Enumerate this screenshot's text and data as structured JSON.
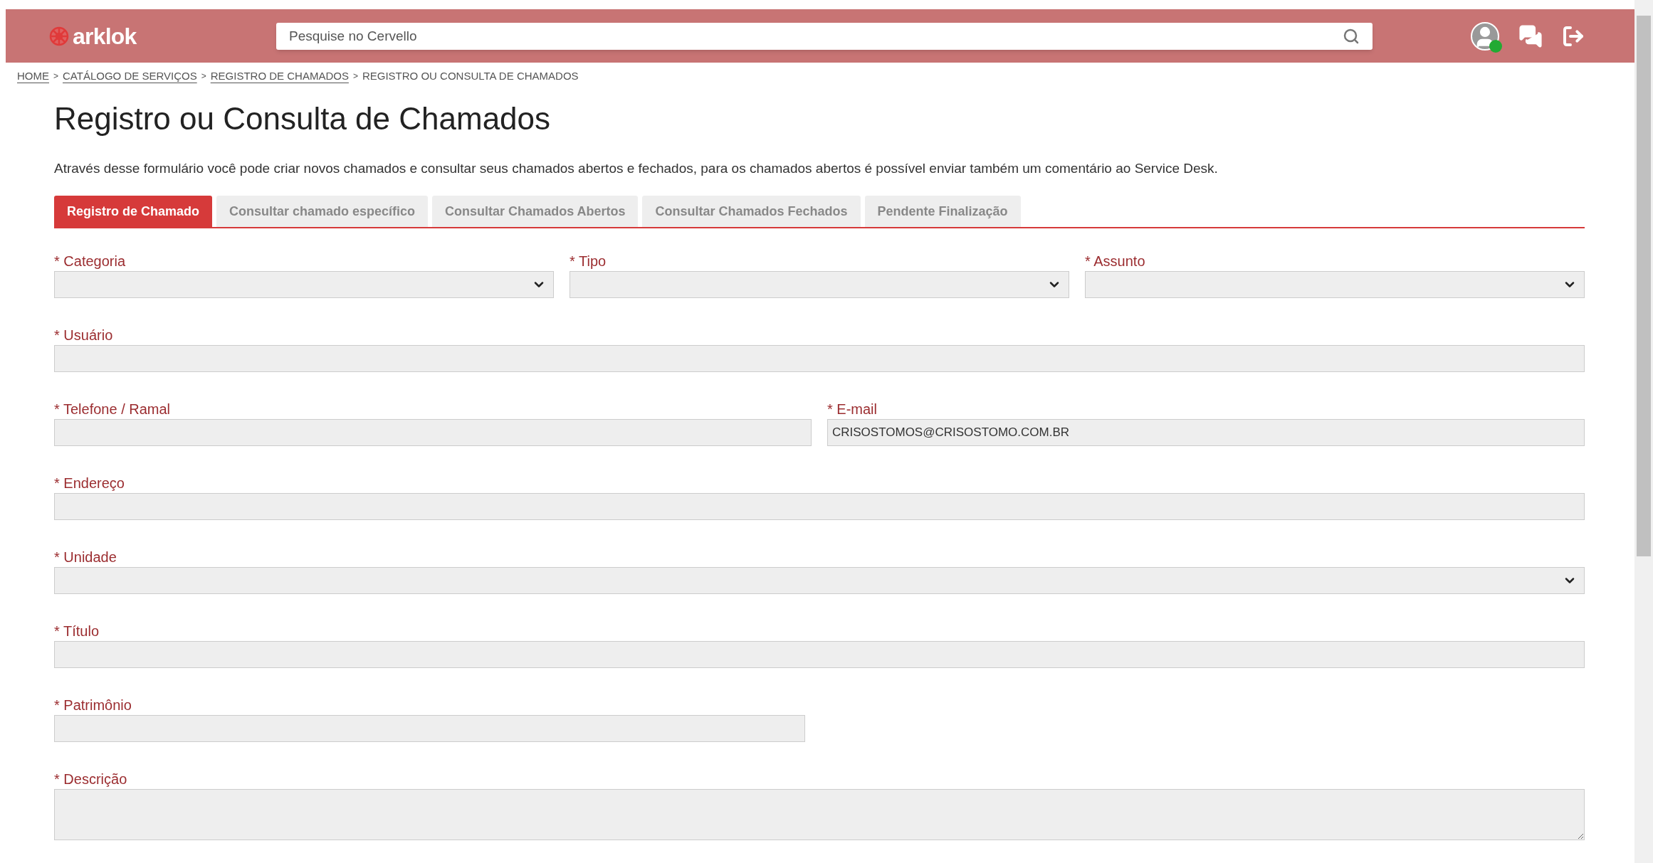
{
  "header": {
    "logo": "arklok",
    "search": {
      "placeholder": "Pesquise no Cervello"
    },
    "user_online": true
  },
  "breadcrumb": [
    {
      "label": "HOME",
      "link": true
    },
    {
      "label": "CATÁLOGO DE SERVIÇOS",
      "link": true
    },
    {
      "label": "REGISTRO DE CHAMADOS",
      "link": true
    },
    {
      "label": "REGISTRO OU CONSULTA DE CHAMADOS",
      "link": false
    }
  ],
  "breadcrumb_separator": ">",
  "title": "Registro ou Consulta de Chamados",
  "description": "Através desse formulário você pode criar novos chamados e consultar seus chamados abertos e fechados, para os chamados abertos é possível enviar também um comentário ao Service Desk.",
  "tabs": [
    {
      "label": "Registro de Chamado",
      "selected": true
    },
    {
      "label": "Consultar chamado específico",
      "selected": false
    },
    {
      "label": "Consultar Chamados Abertos",
      "selected": false
    },
    {
      "label": "Consultar Chamados Fechados",
      "selected": false
    },
    {
      "label": "Pendente Finalização",
      "selected": false
    }
  ],
  "form_rows": [
    [
      {
        "label": "* Categoria",
        "kind": "select"
      },
      {
        "label": "* Tipo",
        "kind": "select"
      },
      {
        "label": "* Assunto",
        "kind": "select"
      }
    ],
    [
      {
        "label": "* Usuário",
        "kind": "text"
      }
    ],
    [
      {
        "label": "* Telefone / Ramal",
        "kind": "text"
      },
      {
        "label": "* E-mail",
        "kind": "text",
        "value": "CRISOSTOMOS@CRISOSTOMO.COM.BR"
      }
    ],
    [
      {
        "label": "* Endereço",
        "kind": "text"
      }
    ],
    [
      {
        "label": "* Unidade",
        "kind": "select"
      }
    ],
    [
      {
        "label": "* Título",
        "kind": "text"
      }
    ],
    [
      {
        "label": "* Patrimônio",
        "kind": "text"
      }
    ],
    [
      {
        "label": "* Descrição",
        "kind": "textarea"
      }
    ]
  ]
}
